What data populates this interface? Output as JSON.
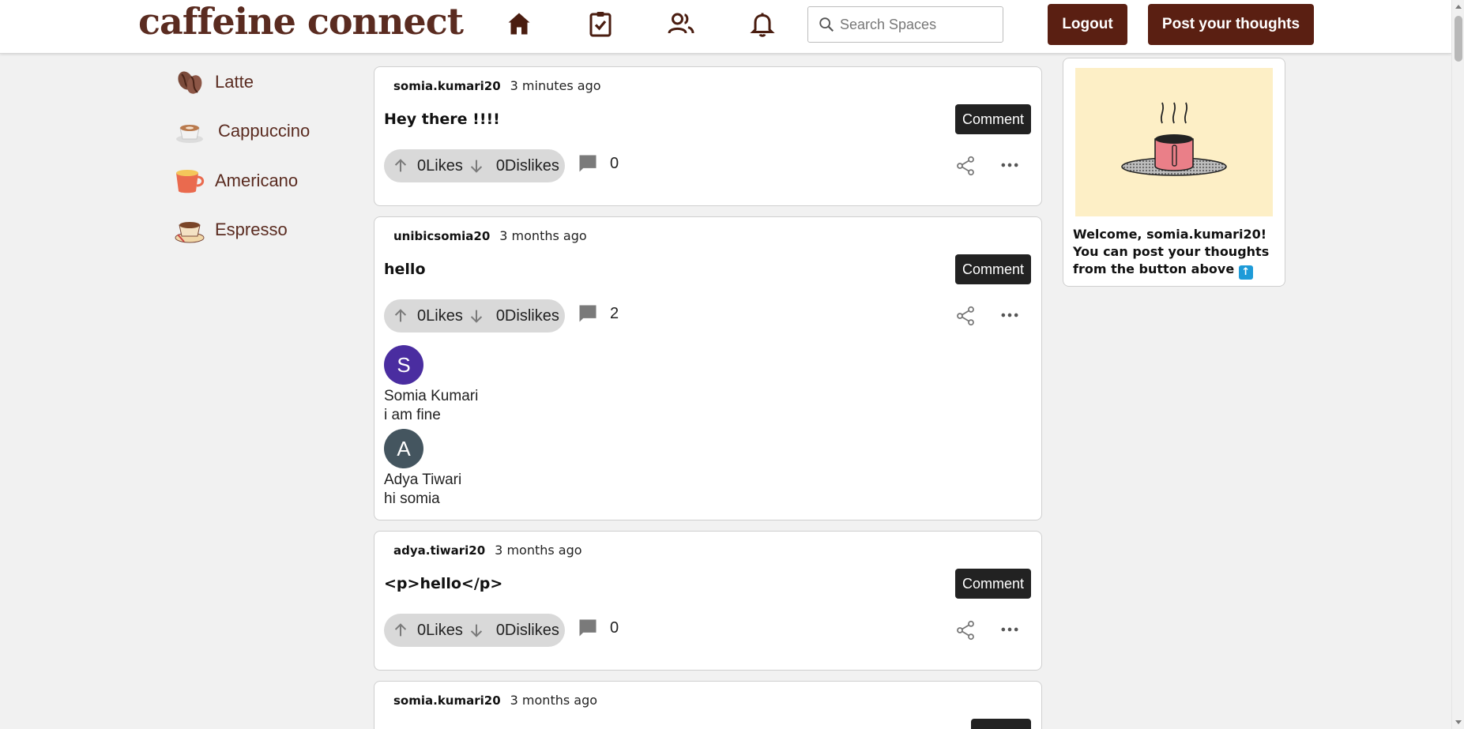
{
  "app": {
    "logo": "caffeine connect",
    "search_placeholder": "Search Spaces",
    "logout_label": "Logout",
    "post_label": "Post your thoughts"
  },
  "colors": {
    "brand": "#5a1f12",
    "logo": "#5a2b20",
    "comment_button": "#222222",
    "avatar_s": "#4a2da0",
    "avatar_a": "#44555f",
    "welcome_art_bg": "#fdefc6"
  },
  "sidebar": {
    "items": [
      {
        "label": "Latte",
        "icon": "coffee-beans-icon"
      },
      {
        "label": "Cappuccino",
        "icon": "cappuccino-cup-icon"
      },
      {
        "label": "Americano",
        "icon": "americano-cup-icon"
      },
      {
        "label": "Espresso",
        "icon": "espresso-cup-icon"
      }
    ]
  },
  "posts": [
    {
      "author": "somia.kumari20",
      "time": "3 minutes ago",
      "title": "Hey there !!!!",
      "comment_label": "Comment",
      "likes": "0Likes",
      "dislikes": "0Dislikes",
      "comments": "0",
      "replies": []
    },
    {
      "author": "unibicsomia20",
      "time": "3 months ago",
      "title": "hello",
      "comment_label": "Comment",
      "likes": "0Likes",
      "dislikes": "0Dislikes",
      "comments": "2",
      "replies": [
        {
          "initial": "S",
          "name": "Somia Kumari",
          "text": "i am fine"
        },
        {
          "initial": "A",
          "name": "Adya Tiwari",
          "text": "hi somia"
        }
      ]
    },
    {
      "author": "adya.tiwari20",
      "time": "3 months ago",
      "title": "<p>hello</p>",
      "comment_label": "Comment",
      "likes": "0Likes",
      "dislikes": "0Dislikes",
      "comments": "0",
      "replies": []
    },
    {
      "author": "somia.kumari20",
      "time": "3 months ago"
    }
  ],
  "welcome": {
    "message": "Welcome, somia.kumari20! You can post your thoughts from the button above",
    "emoji": "up-arrow-emoji"
  }
}
